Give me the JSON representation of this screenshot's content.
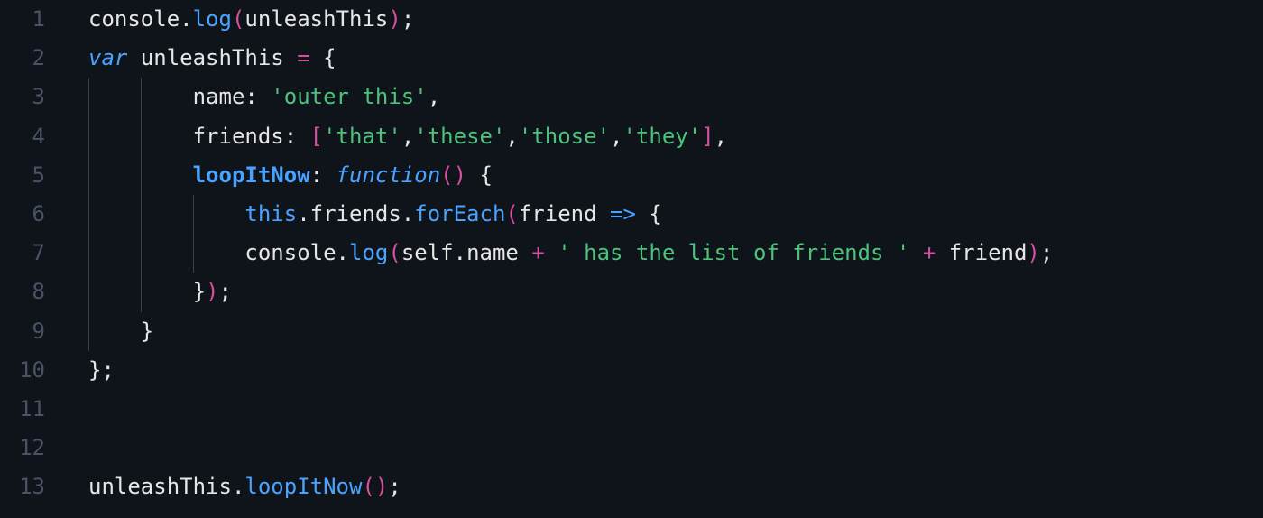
{
  "editor": {
    "gutter": {
      "lines": [
        "1",
        "2",
        "3",
        "4",
        "5",
        "6",
        "7",
        "8",
        "9",
        "10",
        "11",
        "12",
        "13"
      ]
    },
    "code": {
      "lines": [
        [
          {
            "t": "console",
            "c": "tok-obj"
          },
          {
            "t": ".",
            "c": "tok-punct"
          },
          {
            "t": "log",
            "c": "tok-method"
          },
          {
            "t": "(",
            "c": "tok-paren"
          },
          {
            "t": "unleashThis",
            "c": "tok-default"
          },
          {
            "t": ")",
            "c": "tok-paren"
          },
          {
            "t": ";",
            "c": "tok-punct"
          }
        ],
        [
          {
            "t": "var",
            "c": "tok-keyword"
          },
          {
            "t": " ",
            "c": "tok-default"
          },
          {
            "t": "unleashThis",
            "c": "tok-default"
          },
          {
            "t": " ",
            "c": "tok-default"
          },
          {
            "t": "=",
            "c": "tok-op"
          },
          {
            "t": " ",
            "c": "tok-default"
          },
          {
            "t": "{",
            "c": "tok-brace"
          }
        ],
        [
          {
            "t": "        ",
            "c": "tok-default"
          },
          {
            "t": "name",
            "c": "tok-prop"
          },
          {
            "t": ":",
            "c": "tok-punct"
          },
          {
            "t": " ",
            "c": "tok-default"
          },
          {
            "t": "'outer this'",
            "c": "tok-string"
          },
          {
            "t": ",",
            "c": "tok-punct"
          }
        ],
        [
          {
            "t": "        ",
            "c": "tok-default"
          },
          {
            "t": "friends",
            "c": "tok-prop"
          },
          {
            "t": ":",
            "c": "tok-punct"
          },
          {
            "t": " ",
            "c": "tok-default"
          },
          {
            "t": "[",
            "c": "tok-bracket"
          },
          {
            "t": "'that'",
            "c": "tok-string"
          },
          {
            "t": ",",
            "c": "tok-punct"
          },
          {
            "t": "'these'",
            "c": "tok-string"
          },
          {
            "t": ",",
            "c": "tok-punct"
          },
          {
            "t": "'those'",
            "c": "tok-string"
          },
          {
            "t": ",",
            "c": "tok-punct"
          },
          {
            "t": "'they'",
            "c": "tok-string"
          },
          {
            "t": "]",
            "c": "tok-bracket"
          },
          {
            "t": ",",
            "c": "tok-punct"
          }
        ],
        [
          {
            "t": "        ",
            "c": "tok-default"
          },
          {
            "t": "loopItNow",
            "c": "tok-funcdef"
          },
          {
            "t": ":",
            "c": "tok-punct"
          },
          {
            "t": " ",
            "c": "tok-default"
          },
          {
            "t": "function",
            "c": "tok-funckw"
          },
          {
            "t": "(",
            "c": "tok-paren"
          },
          {
            "t": ")",
            "c": "tok-paren"
          },
          {
            "t": " ",
            "c": "tok-default"
          },
          {
            "t": "{",
            "c": "tok-brace"
          }
        ],
        [
          {
            "t": "            ",
            "c": "tok-default"
          },
          {
            "t": "this",
            "c": "tok-this"
          },
          {
            "t": ".",
            "c": "tok-punct"
          },
          {
            "t": "friends",
            "c": "tok-prop"
          },
          {
            "t": ".",
            "c": "tok-punct"
          },
          {
            "t": "forEach",
            "c": "tok-method"
          },
          {
            "t": "(",
            "c": "tok-paren"
          },
          {
            "t": "friend",
            "c": "tok-param"
          },
          {
            "t": " ",
            "c": "tok-default"
          },
          {
            "t": "=>",
            "c": "tok-arrow"
          },
          {
            "t": " ",
            "c": "tok-default"
          },
          {
            "t": "{",
            "c": "tok-brace"
          }
        ],
        [
          {
            "t": "            ",
            "c": "tok-default"
          },
          {
            "t": "console",
            "c": "tok-obj"
          },
          {
            "t": ".",
            "c": "tok-punct"
          },
          {
            "t": "log",
            "c": "tok-method"
          },
          {
            "t": "(",
            "c": "tok-paren"
          },
          {
            "t": "self",
            "c": "tok-self"
          },
          {
            "t": ".",
            "c": "tok-punct"
          },
          {
            "t": "name",
            "c": "tok-prop"
          },
          {
            "t": " ",
            "c": "tok-default"
          },
          {
            "t": "+",
            "c": "tok-op"
          },
          {
            "t": " ",
            "c": "tok-default"
          },
          {
            "t": "' has the list of friends '",
            "c": "tok-string"
          },
          {
            "t": " ",
            "c": "tok-default"
          },
          {
            "t": "+",
            "c": "tok-op"
          },
          {
            "t": " ",
            "c": "tok-default"
          },
          {
            "t": "friend",
            "c": "tok-default"
          },
          {
            "t": ")",
            "c": "tok-paren"
          },
          {
            "t": ";",
            "c": "tok-punct"
          }
        ],
        [
          {
            "t": "        ",
            "c": "tok-default"
          },
          {
            "t": "}",
            "c": "tok-brace"
          },
          {
            "t": ")",
            "c": "tok-paren"
          },
          {
            "t": ";",
            "c": "tok-punct"
          }
        ],
        [
          {
            "t": "    ",
            "c": "tok-default"
          },
          {
            "t": "}",
            "c": "tok-brace"
          }
        ],
        [
          {
            "t": "}",
            "c": "tok-brace"
          },
          {
            "t": ";",
            "c": "tok-punct"
          }
        ],
        [],
        [],
        [
          {
            "t": "unleashThis",
            "c": "tok-default"
          },
          {
            "t": ".",
            "c": "tok-punct"
          },
          {
            "t": "loopItNow",
            "c": "tok-method"
          },
          {
            "t": "(",
            "c": "tok-paren"
          },
          {
            "t": ")",
            "c": "tok-paren"
          },
          {
            "t": ";",
            "c": "tok-punct"
          }
        ]
      ],
      "indentGuides": [
        {
          "line": 3,
          "cols": [
            0,
            4
          ]
        },
        {
          "line": 4,
          "cols": [
            0,
            4
          ]
        },
        {
          "line": 5,
          "cols": [
            0,
            4
          ]
        },
        {
          "line": 6,
          "cols": [
            0,
            4,
            8
          ]
        },
        {
          "line": 7,
          "cols": [
            0,
            4,
            8
          ]
        },
        {
          "line": 8,
          "cols": [
            0,
            4
          ]
        },
        {
          "line": 9,
          "cols": [
            0
          ]
        }
      ]
    }
  }
}
